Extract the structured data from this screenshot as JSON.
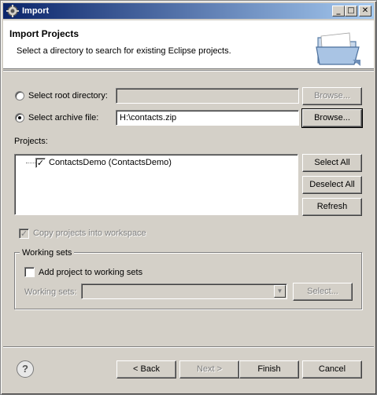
{
  "window": {
    "title": "Import",
    "title_icon": "eclipse-gear-icon",
    "controls": {
      "minimize": "_",
      "maximize": "□",
      "close": "✕"
    }
  },
  "banner": {
    "title": "Import Projects",
    "description": "Select a directory to search for existing Eclipse projects.",
    "icon": "folder-icon"
  },
  "source": {
    "root_directory": {
      "label": "Select root directory:",
      "value": "",
      "selected": false,
      "browse_label": "Browse..."
    },
    "archive_file": {
      "label": "Select archive file:",
      "value": "H:\\contacts.zip",
      "selected": true,
      "browse_label": "Browse..."
    }
  },
  "projects": {
    "label": "Projects:",
    "items": [
      {
        "label": "ContactsDemo (ContactsDemo)",
        "checked": true
      }
    ],
    "buttons": {
      "select_all": "Select All",
      "deselect_all": "Deselect All",
      "refresh": "Refresh"
    }
  },
  "copy_projects": {
    "label": "Copy projects into workspace",
    "checked": true,
    "enabled": false
  },
  "working_sets": {
    "group_label": "Working sets",
    "add_label": "Add project to working sets",
    "add_checked": false,
    "sets_label": "Working sets:",
    "sets_value": "",
    "select_label": "Select..."
  },
  "footer": {
    "help": "?",
    "back": "< Back",
    "next": "Next >",
    "finish": "Finish",
    "cancel": "Cancel"
  },
  "colors": {
    "titlebar_start": "#0a246a",
    "titlebar_end": "#a6caf0",
    "face": "#d4d0c8"
  }
}
